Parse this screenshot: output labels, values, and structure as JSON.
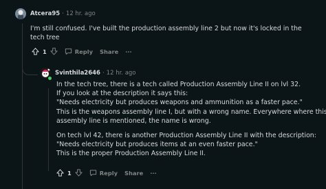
{
  "comment1": {
    "username": "Atcera95",
    "age": "12 hr. ago",
    "lines": [
      "I'm still confused. I've built the production assembly line 2 but now it's locked in the",
      "tech tree"
    ],
    "votes": "1",
    "reply_label": "Reply",
    "share_label": "Share",
    "more_label": "···"
  },
  "comment2": {
    "username": "Svinthila2646",
    "age": "12 hr. ago",
    "paragraph1": [
      "In the tech tree, there is a tech called Production Assembly Line II on lvl 32.",
      "If you look at the description it says this:",
      "\"Needs electricity but produces weapons and ammunition as a faster pace.\"",
      "This is the weapons assembly line I, but with a wrong name. Everywhere where this",
      "assembly line is mentioned, the name is wrong."
    ],
    "paragraph2": [
      "On tech lvl 42, there is another Production Assembly Line II with the description:",
      "\"Needs electricity but produces items at an even faster pace.\"",
      "This is the proper Production Assembly Line II."
    ],
    "votes": "1",
    "reply_label": "Reply",
    "share_label": "Share",
    "more_label": "···"
  },
  "colors": {
    "background": "#0b1416",
    "text": "#d7dadc",
    "muted": "#818384",
    "online": "#46d160"
  }
}
